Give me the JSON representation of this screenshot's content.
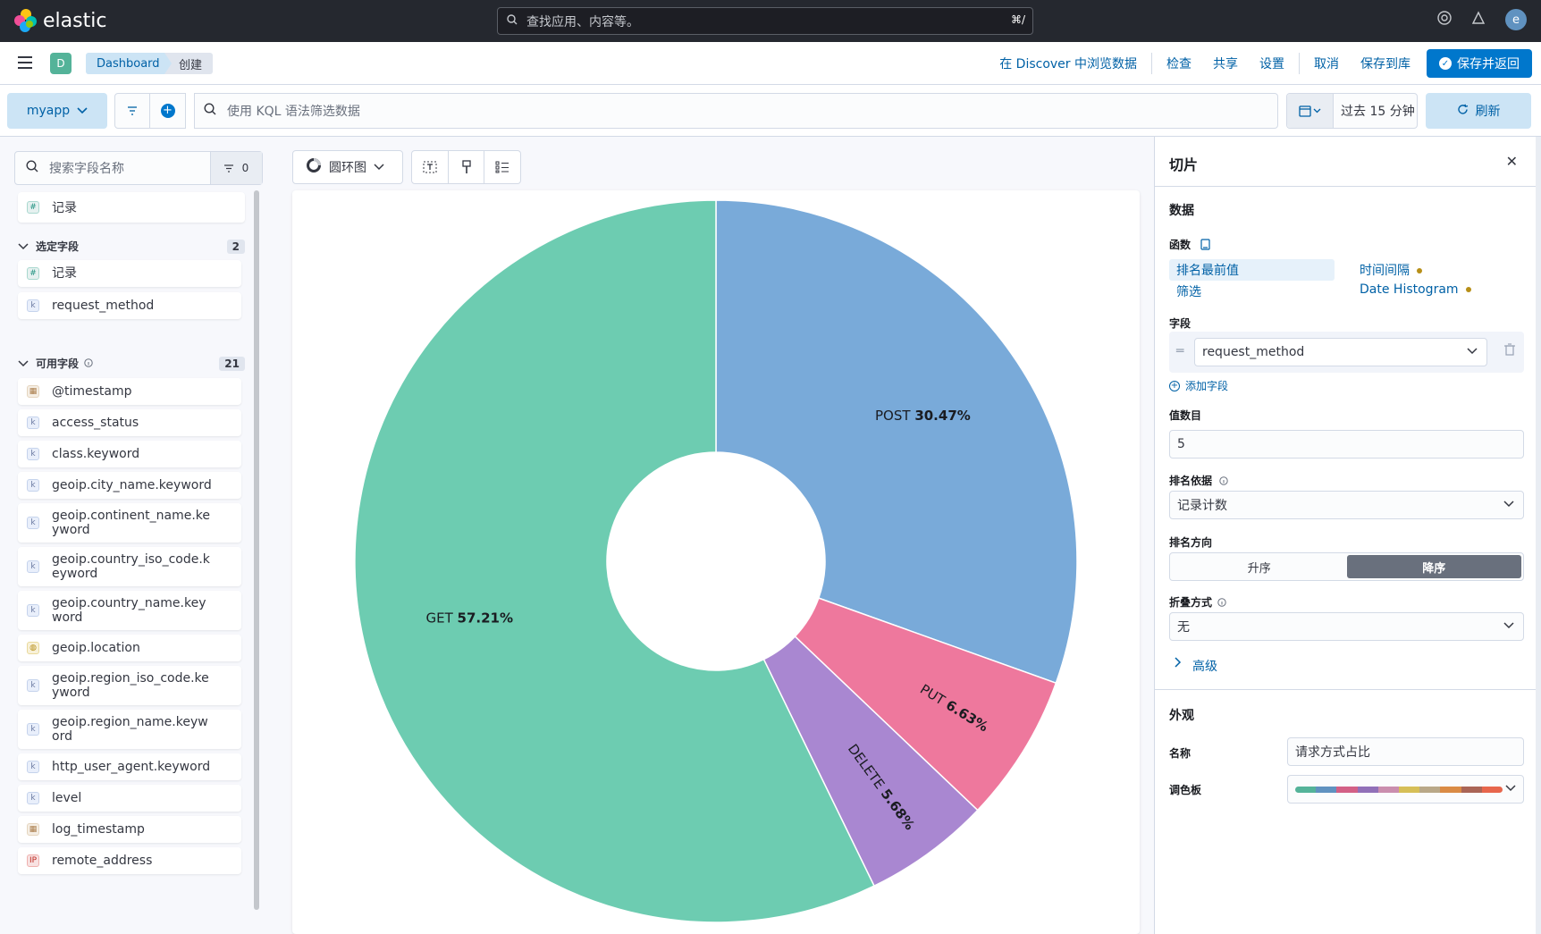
{
  "header": {
    "brand": "elastic",
    "search_placeholder": "查找应用、内容等。",
    "search_shortcut": "⌘/",
    "user_initial": "e"
  },
  "appbar": {
    "space_initial": "D",
    "breadcrumbs": [
      "Dashboard",
      "创建"
    ],
    "actions": [
      "在 Discover 中浏览数据",
      "检查",
      "共享",
      "设置",
      "取消",
      "保存到库"
    ],
    "primary_action": "保存并返回"
  },
  "querybar": {
    "data_view": "myapp",
    "kql_placeholder": "使用 KQL 语法筛选数据",
    "time_range": "过去 15 分钟",
    "refresh_label": "刷新"
  },
  "fields": {
    "search_placeholder": "搜索字段名称",
    "filter_count": "0",
    "records_label": "记录",
    "selected": {
      "title": "选定字段",
      "count": "2",
      "items": [
        {
          "name": "记录",
          "type": "number"
        },
        {
          "name": "request_method",
          "type": "keyword"
        }
      ]
    },
    "available": {
      "title": "可用字段",
      "count": "21",
      "items": [
        {
          "name": "@timestamp",
          "type": "date"
        },
        {
          "name": "access_status",
          "type": "keyword"
        },
        {
          "name": "class.keyword",
          "type": "keyword"
        },
        {
          "name": "geoip.city_name.keyword",
          "type": "keyword"
        },
        {
          "name": "geoip.continent_name.ke\nyword",
          "type": "keyword"
        },
        {
          "name": "geoip.country_iso_code.k\neyword",
          "type": "keyword"
        },
        {
          "name": "geoip.country_name.key\nword",
          "type": "keyword"
        },
        {
          "name": "geoip.location",
          "type": "geo"
        },
        {
          "name": "geoip.region_iso_code.ke\nyword",
          "type": "keyword"
        },
        {
          "name": "geoip.region_name.keyw\nord",
          "type": "keyword"
        },
        {
          "name": "http_user_agent.keyword",
          "type": "keyword"
        },
        {
          "name": "level",
          "type": "keyword"
        },
        {
          "name": "log_timestamp",
          "type": "date"
        },
        {
          "name": "remote_address",
          "type": "ip"
        }
      ]
    }
  },
  "workspace": {
    "chart_type_label": "圆环图"
  },
  "chart_data": {
    "type": "pie",
    "donut": true,
    "categories": [
      "POST",
      "PUT",
      "DELETE",
      "GET"
    ],
    "values": [
      30.47,
      6.63,
      5.68,
      57.21
    ],
    "percent_labels": [
      "30.47%",
      "6.63%",
      "5.68%",
      "57.21%"
    ],
    "colors": [
      "#79aad9",
      "#ee789d",
      "#a987d1",
      "#6dccb1"
    ]
  },
  "config": {
    "title": "切片",
    "data_section": "数据",
    "function_label": "函数",
    "functions": [
      {
        "label": "排名最前值",
        "active": true
      },
      {
        "label": "时间间隔",
        "warn": true
      },
      {
        "label": "筛选"
      },
      {
        "label": "Date Histogram",
        "warn": true
      }
    ],
    "field_label": "字段",
    "field_value": "request_method",
    "add_field": "添加字段",
    "num_values_label": "值数目",
    "num_values": "5",
    "rank_by_label": "排名依据",
    "rank_by": "记录计数",
    "rank_dir_label": "排名方向",
    "rank_asc": "升序",
    "rank_desc": "降序",
    "collapse_label": "折叠方式",
    "collapse_value": "无",
    "advanced": "高级",
    "appearance_section": "外观",
    "name_label": "名称",
    "name_value": "请求方式占比",
    "palette_label": "调色板",
    "palette_colors": [
      "#54b399",
      "#6092c0",
      "#d36086",
      "#9170b8",
      "#ca8eae",
      "#d6bf57",
      "#b9a888",
      "#da8b45",
      "#aa6556",
      "#e7664c"
    ]
  }
}
